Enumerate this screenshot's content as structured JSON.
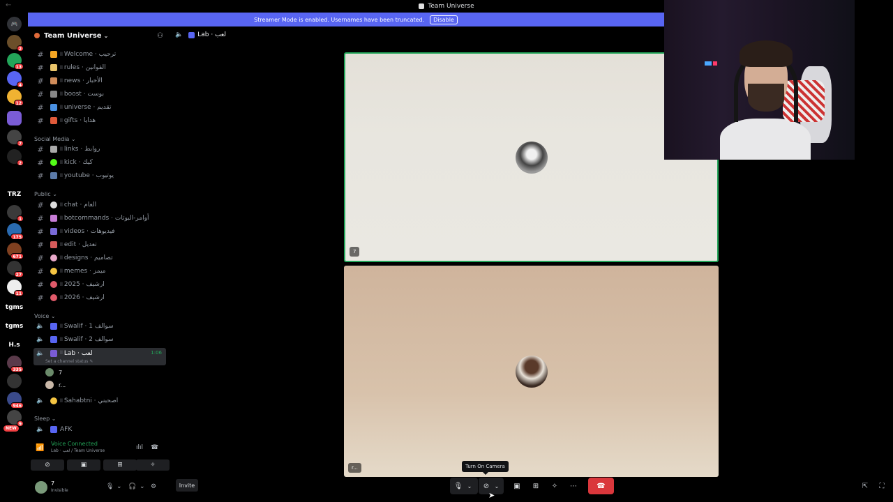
{
  "window": {
    "title": "Team Universe"
  },
  "banner": {
    "text": "Streamer Mode is enabled. Usernames have been truncated.",
    "button": "Disable"
  },
  "rail": {
    "badges": [
      "2",
      "13",
      "4",
      "12",
      "7",
      "2",
      "1",
      "175",
      "671",
      "27",
      "11",
      "335",
      "946",
      "9"
    ],
    "text_servers": [
      "TRZ",
      "tgms",
      "tgms",
      "H.s"
    ],
    "new_label": "NEW"
  },
  "guild": {
    "name": "Team Universe"
  },
  "channels": {
    "top": [
      {
        "label": "Welcome · ترحيب"
      },
      {
        "label": "rules · القوانين"
      },
      {
        "label": "news · الأخبار"
      },
      {
        "label": "boost · بوست"
      },
      {
        "label": "universe · تقديم"
      },
      {
        "label": "gifts · هدايا"
      }
    ],
    "social_title": "Social Media",
    "social": [
      {
        "label": "links · روابط"
      },
      {
        "label": "kick · كيك"
      },
      {
        "label": "youtube · يوتيوب"
      }
    ],
    "public_title": "Public",
    "public": [
      {
        "label": "chat · العام"
      },
      {
        "label": "botcommands · أوامر-البوتات"
      },
      {
        "label": "videos · فيديوهات"
      },
      {
        "label": "edit · تعديل"
      },
      {
        "label": "designs · تصاميم"
      },
      {
        "label": "memes · ميمز"
      },
      {
        "label": "2025 · ارشيف"
      },
      {
        "label": "2026 · ارشيف"
      }
    ],
    "voice_title": "Voice",
    "voice": [
      {
        "label": "Swalif · 1 سوالف"
      },
      {
        "label": "Swalif · 2 سوالف"
      }
    ],
    "active_voice": {
      "label": "Lab · لعب",
      "timer": "1:06",
      "status": "Set a channel status"
    },
    "voice_users": [
      {
        "name": "7"
      },
      {
        "name": "r..."
      }
    ],
    "sahabtni": {
      "label": "Sahabtni · اصحبني"
    },
    "sleep_title": "Sleep",
    "afk": {
      "label": "AFK"
    }
  },
  "voice_panel": {
    "status": "Voice Connected",
    "sub": "Lab · لعب / Team Universe"
  },
  "user_panel": {
    "name": "7",
    "status": "Invisible"
  },
  "main": {
    "header": "Lab · لعب",
    "tile1_label": "7",
    "tile2_label": "r...",
    "invite": "Invite",
    "tooltip": "Turn On Camera"
  },
  "colors": {
    "accent": "#5865f2",
    "voice_green": "#23a559",
    "hangup": "#da373c"
  }
}
